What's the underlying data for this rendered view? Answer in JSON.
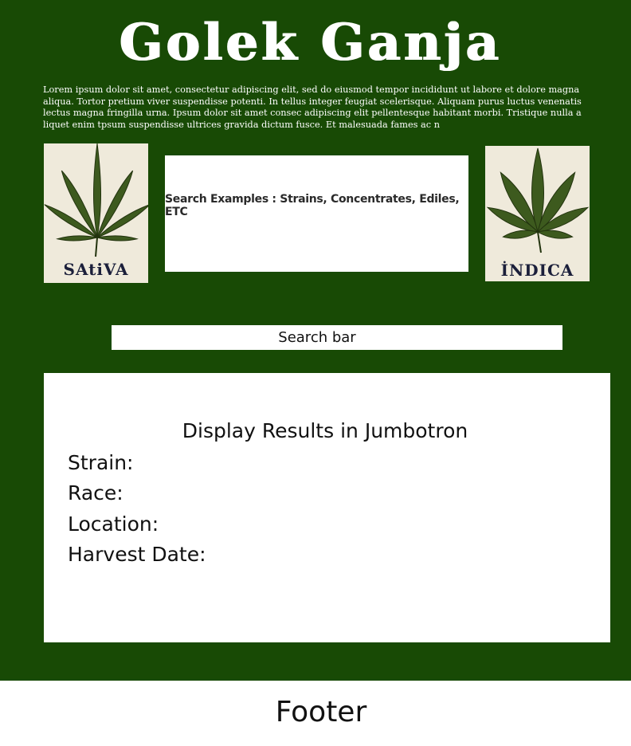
{
  "header": {
    "title": "Golek Ganja",
    "intro": "Lorem ipsum dolor sit amet, consectetur adipiscing elit, sed do eiusmod tempor incididunt ut labore et dolore magna aliqua. Tortor pretium viver suspendisse potenti. In tellus integer feugiat scelerisque. Aliquam purus  luctus venenatis lectus magna fringilla urna. Ipsum dolor sit amet consec adipiscing elit pellentesque habitant morbi. Tristique nulla a liquet enim tpsum suspendisse ultrices gravida dictum fusce. Et malesuada fames ac n"
  },
  "cards": {
    "sativa": {
      "label": "SAtiVA",
      "icon": "cannabis-leaf-icon"
    },
    "indica": {
      "label": "İNDICA",
      "icon": "cannabis-leaf-icon"
    }
  },
  "examples": {
    "text": "Search Examples : Strains, Concentrates, Ediles, ETC"
  },
  "search": {
    "label": "Search bar"
  },
  "jumbotron": {
    "title": "Display Results in Jumbotron",
    "fields": {
      "strain": "Strain:",
      "race": "Race:",
      "location": "Location:",
      "harvest_date": "Harvest Date:"
    }
  },
  "footer": {
    "label": "Footer"
  },
  "colors": {
    "background_green": "#184a05",
    "card_background": "#efeadb",
    "leaf_green": "#3d5a1e",
    "label_navy": "#1b1f3a"
  }
}
